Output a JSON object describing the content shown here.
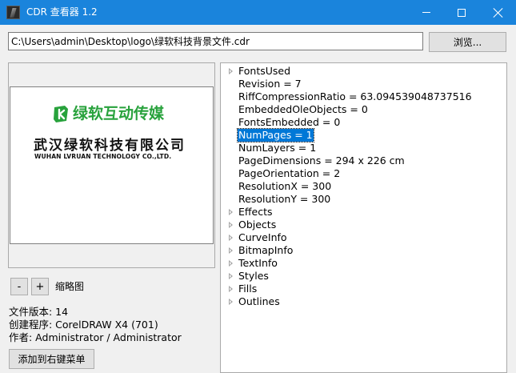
{
  "window": {
    "title": "CDR 查看器 1.2"
  },
  "path": {
    "value": "C:\\Users\\admin\\Desktop\\logo\\绿软科技背景文件.cdr",
    "browse_label": "浏览..."
  },
  "preview": {
    "logo_text": "绿软互动传媒",
    "company_cn": "武汉绿软科技有限公司",
    "company_en": "WUHAN LVRUAN TECHNOLOGY CO.,LTD.",
    "logo_color": "#28a23c"
  },
  "controls": {
    "zoom_out": "-",
    "zoom_in": "+",
    "thumbnail_label": "缩略图"
  },
  "info": {
    "version": "文件版本: 14",
    "creator": "创建程序: CorelDRAW X4 (701)",
    "author": "作者: Administrator / Administrator"
  },
  "add_menu_label": "添加到右键菜单",
  "tree": [
    {
      "label": "FontsUsed",
      "expandable": true
    },
    {
      "label": "Revision = 7",
      "expandable": false
    },
    {
      "label": "RiffCompressionRatio = 63.094539048737516",
      "expandable": false
    },
    {
      "label": "EmbeddedOleObjects = 0",
      "expandable": false
    },
    {
      "label": "FontsEmbedded = 0",
      "expandable": false
    },
    {
      "label": "NumPages = 1",
      "expandable": false,
      "selected": true
    },
    {
      "label": "NumLayers = 1",
      "expandable": false
    },
    {
      "label": "PageDimensions = 294 x 226 cm",
      "expandable": false
    },
    {
      "label": "PageOrientation = 2",
      "expandable": false
    },
    {
      "label": "ResolutionX = 300",
      "expandable": false
    },
    {
      "label": "ResolutionY = 300",
      "expandable": false
    },
    {
      "label": "Effects",
      "expandable": true
    },
    {
      "label": "Objects",
      "expandable": true
    },
    {
      "label": "CurveInfo",
      "expandable": true
    },
    {
      "label": "BitmapInfo",
      "expandable": true
    },
    {
      "label": "TextInfo",
      "expandable": true
    },
    {
      "label": "Styles",
      "expandable": true
    },
    {
      "label": "Fills",
      "expandable": true
    },
    {
      "label": "Outlines",
      "expandable": true
    }
  ],
  "colors": {
    "titlebar": "#1a84dc",
    "selection": "#0078d7"
  }
}
